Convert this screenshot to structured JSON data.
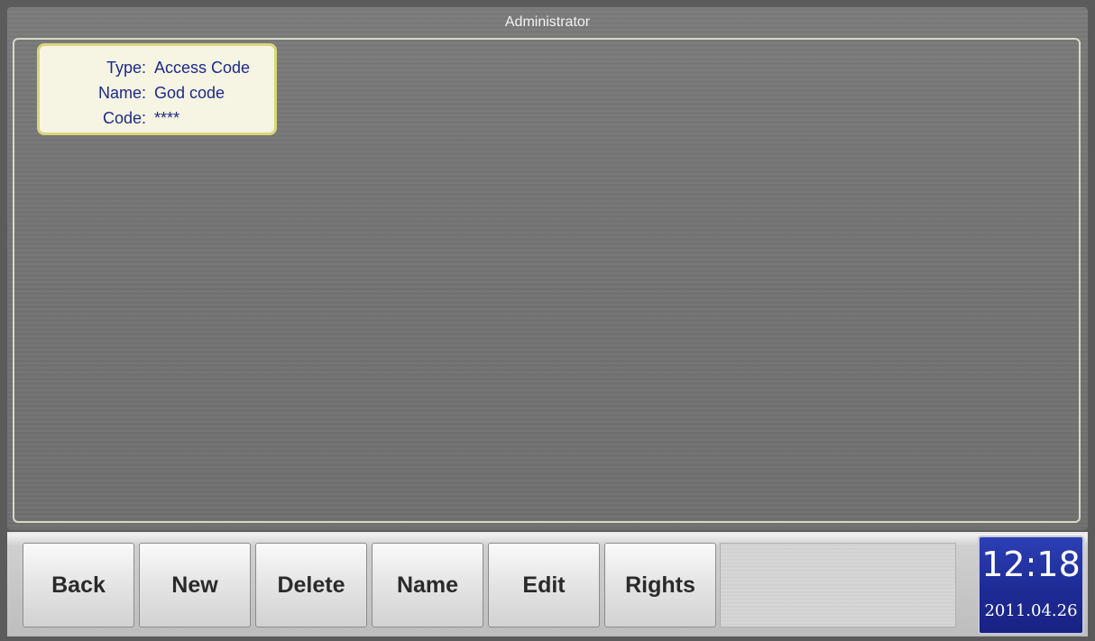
{
  "window": {
    "title": "Administrator"
  },
  "card": {
    "type_label": "Type:",
    "type_value": "Access Code",
    "name_label": "Name:",
    "name_value": "God code",
    "code_label": "Code:",
    "code_value": "****"
  },
  "toolbar": {
    "buttons": [
      {
        "label": "Back"
      },
      {
        "label": "New"
      },
      {
        "label": "Delete"
      },
      {
        "label": "Name"
      },
      {
        "label": "Edit"
      },
      {
        "label": "Rights"
      }
    ]
  },
  "clock": {
    "time": "12:18",
    "date": "2011.04.26"
  },
  "colors": {
    "panel_bg": "#737373",
    "card_bg": "#f6f4e2",
    "card_border": "#d9d67a",
    "card_text": "#1c2a8a",
    "clock_bg": "#1e2b95"
  }
}
